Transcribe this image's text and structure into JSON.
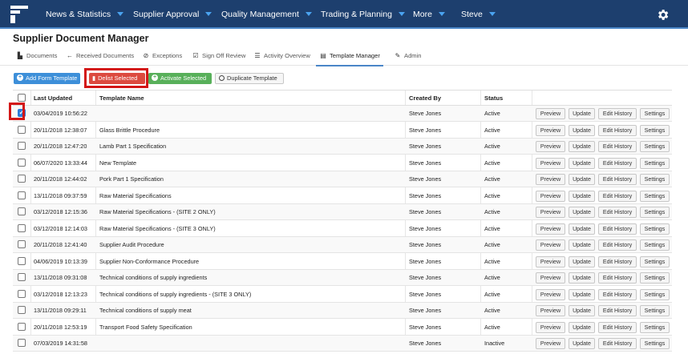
{
  "nav": {
    "items": [
      {
        "label": "News & Statistics"
      },
      {
        "label": "Supplier Approval"
      },
      {
        "label": "Quality Management"
      },
      {
        "label": "Trading & Planning"
      },
      {
        "label": "More"
      },
      {
        "label": "Steve"
      }
    ],
    "logo_icon": "logo-icon",
    "settings_icon": "gear-icon"
  },
  "page": {
    "title": "Supplier Document Manager"
  },
  "subnav": {
    "tabs": [
      {
        "label": "Documents",
        "icon": "document-icon"
      },
      {
        "label": "Received Documents",
        "icon": "arrow-left-icon"
      },
      {
        "label": "Exceptions",
        "icon": "check-circle-icon"
      },
      {
        "label": "Sign Off Review",
        "icon": "check-square-icon"
      },
      {
        "label": "Activity Overview",
        "icon": "list-icon"
      },
      {
        "label": "Template Manager",
        "icon": "template-icon"
      },
      {
        "label": "Admin",
        "icon": "wrench-icon"
      }
    ],
    "active": "Template Manager"
  },
  "toolbar": {
    "add_label": "Add Form Template",
    "delist_label": "Delist Selected",
    "activate_label": "Activate Selected",
    "duplicate_label": "Duplicate Template"
  },
  "table": {
    "headers": {
      "last_updated": "Last Updated",
      "template_name": "Template Name",
      "created_by": "Created By",
      "status": "Status"
    },
    "actions": {
      "preview": "Preview",
      "update": "Update",
      "edit_history": "Edit History",
      "settings": "Settings"
    },
    "rows": [
      {
        "checked": true,
        "last_updated": "03/04/2019 10:56:22",
        "template_name": "",
        "created_by": "Steve Jones",
        "status": "Active"
      },
      {
        "checked": false,
        "last_updated": "20/11/2018 12:38:07",
        "template_name": "Glass Brittle Procedure",
        "created_by": "Steve Jones",
        "status": "Active"
      },
      {
        "checked": false,
        "last_updated": "20/11/2018 12:47:20",
        "template_name": "Lamb Part 1 Specification",
        "created_by": "Steve Jones",
        "status": "Active"
      },
      {
        "checked": false,
        "last_updated": "06/07/2020 13:33:44",
        "template_name": "New Template",
        "created_by": "Steve Jones",
        "status": "Active"
      },
      {
        "checked": false,
        "last_updated": "20/11/2018 12:44:02",
        "template_name": "Pork Part 1 Specification",
        "created_by": "Steve Jones",
        "status": "Active"
      },
      {
        "checked": false,
        "last_updated": "13/11/2018 09:37:59",
        "template_name": "Raw Material Specifications",
        "created_by": "Steve Jones",
        "status": "Active"
      },
      {
        "checked": false,
        "last_updated": "03/12/2018 12:15:36",
        "template_name": "Raw Material Specifications - (SITE 2 ONLY)",
        "created_by": "Steve Jones",
        "status": "Active"
      },
      {
        "checked": false,
        "last_updated": "03/12/2018 12:14:03",
        "template_name": "Raw Material Specifications - (SITE 3 ONLY)",
        "created_by": "Steve Jones",
        "status": "Active"
      },
      {
        "checked": false,
        "last_updated": "20/11/2018 12:41:40",
        "template_name": "Supplier Audit Procedure",
        "created_by": "Steve Jones",
        "status": "Active"
      },
      {
        "checked": false,
        "last_updated": "04/06/2019 10:13:39",
        "template_name": "Supplier Non-Conformance Procedure",
        "created_by": "Steve Jones",
        "status": "Active"
      },
      {
        "checked": false,
        "last_updated": "13/11/2018 09:31:08",
        "template_name": "Technical conditions of supply ingredients",
        "created_by": "Steve Jones",
        "status": "Active"
      },
      {
        "checked": false,
        "last_updated": "03/12/2018 12:13:23",
        "template_name": "Technical conditions of supply ingredients - (SITE 3 ONLY)",
        "created_by": "Steve Jones",
        "status": "Active"
      },
      {
        "checked": false,
        "last_updated": "13/11/2018 09:29:11",
        "template_name": "Technical conditions of supply meat",
        "created_by": "Steve Jones",
        "status": "Active"
      },
      {
        "checked": false,
        "last_updated": "20/11/2018 12:53:19",
        "template_name": "Transport Food Safety Specification",
        "created_by": "Steve Jones",
        "status": "Active"
      },
      {
        "checked": false,
        "last_updated": "07/03/2019 14:31:58",
        "template_name": "",
        "created_by": "Steve Jones",
        "status": "Inactive"
      }
    ]
  },
  "colors": {
    "nav_bg": "#1d3f6e",
    "accent": "#4a86c8",
    "highlight": "#d31616",
    "danger": "#dc4a3f",
    "success": "#58b05a",
    "primary": "#3d8fd9"
  }
}
